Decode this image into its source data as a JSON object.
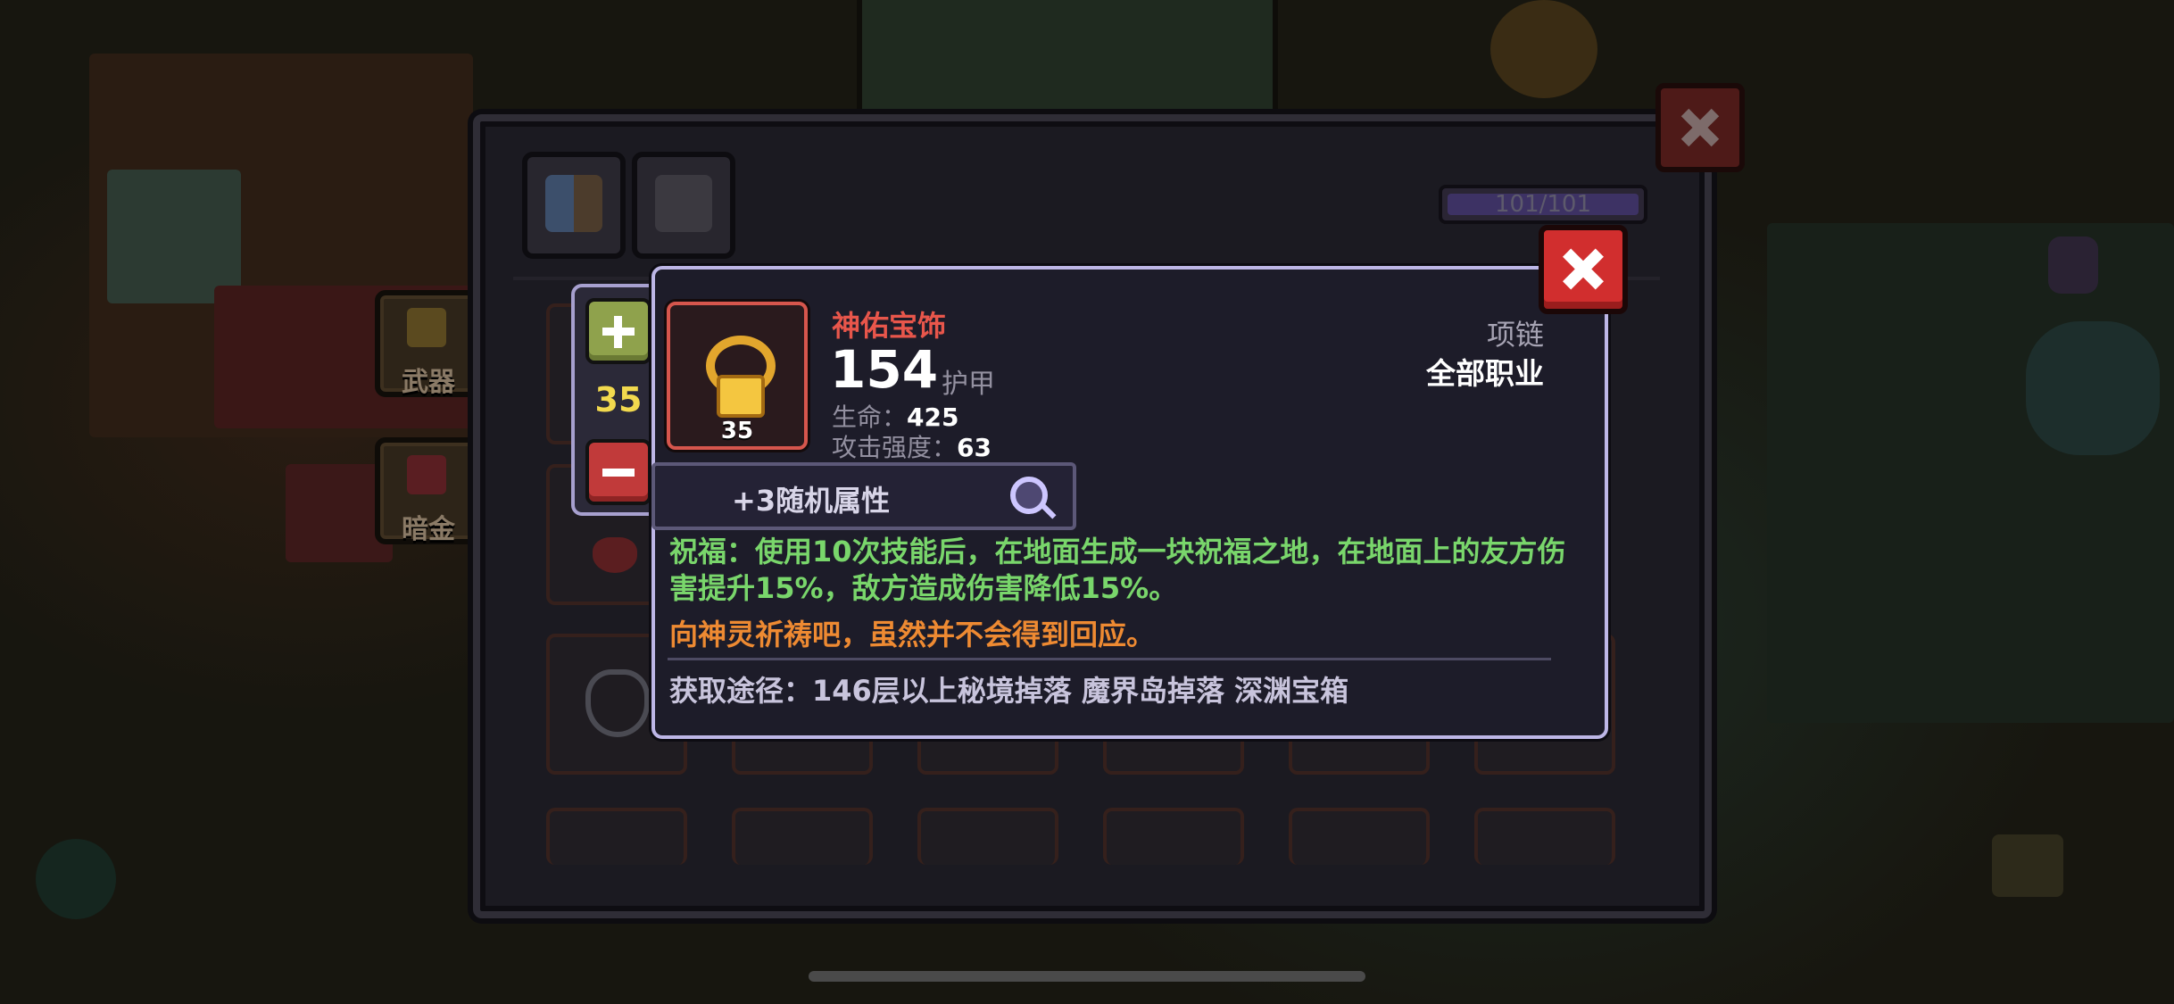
{
  "sidebar": {
    "weapon_label": "武器",
    "darkgold_label": "暗金"
  },
  "inventory": {
    "capacity_text": "101/101"
  },
  "stepper": {
    "level": "35"
  },
  "item": {
    "name": "神佑宝饰",
    "icon_level": "35",
    "armor_value": "154",
    "armor_label": "护甲",
    "slot_type": "项链",
    "class_requirement": "全部职业",
    "stats": [
      {
        "label": "生命：",
        "value": "425"
      },
      {
        "label": "攻击强度：",
        "value": "63"
      }
    ],
    "random_attributes": "+3随机属性",
    "blessing_text": "祝福：使用10次技能后，在地面生成一块祝福之地，在地面上的友方伤害提升15%，敌方造成伤害降低15%。",
    "flavor_text": "向神灵祈祷吧，虽然并不会得到回应。",
    "source_text": "获取途径：146层以上秘境掉落 魔界岛掉落 深渊宝箱"
  },
  "colors": {
    "item_name": "#e8564b",
    "blessing": "#79d66b",
    "flavor": "#ee8a32",
    "close_button": "#d12e2e",
    "level_text": "#f2d94e"
  }
}
